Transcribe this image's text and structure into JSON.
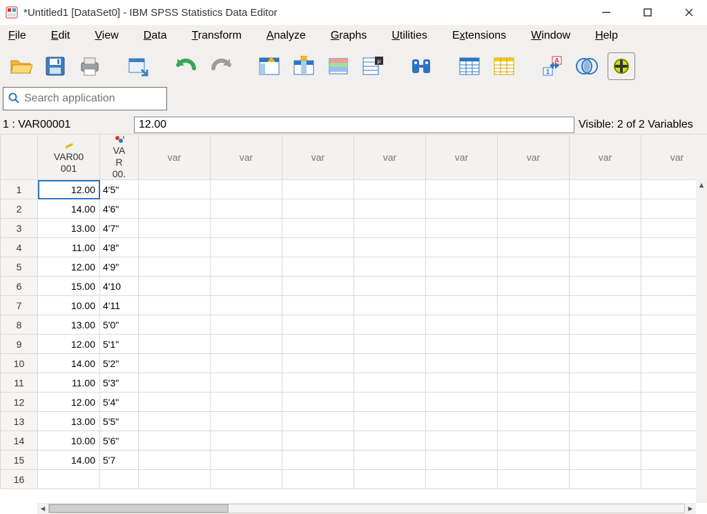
{
  "title": "*Untitled1 [DataSet0] - IBM SPSS Statistics Data Editor",
  "menu": {
    "file": {
      "label": "File",
      "ul": "F"
    },
    "edit": {
      "label": "Edit",
      "ul": "E"
    },
    "view": {
      "label": "View",
      "ul": "V"
    },
    "data": {
      "label": "Data",
      "ul": "D"
    },
    "transform": {
      "label": "Transform",
      "ul": "T"
    },
    "analyze": {
      "label": "Analyze",
      "ul": "A"
    },
    "graphs": {
      "label": "Graphs",
      "ul": "G"
    },
    "utilities": {
      "label": "Utilities",
      "ul": "U"
    },
    "extensions": {
      "label": "Extensions",
      "ul": "x"
    },
    "window": {
      "label": "Window",
      "ul": "W"
    },
    "help": {
      "label": "Help",
      "ul": "H"
    }
  },
  "search": {
    "placeholder": "Search application"
  },
  "cellref": {
    "label": "1 : VAR00001",
    "value": "12.00"
  },
  "visible": "Visible: 2 of 2 Variables",
  "headers": {
    "var1": "VAR00001",
    "var2": "VAR00.",
    "empty": "var"
  },
  "rows": [
    {
      "n": "1",
      "v1": "12.00",
      "v2": "4'5\""
    },
    {
      "n": "2",
      "v1": "14.00",
      "v2": "4'6\""
    },
    {
      "n": "3",
      "v1": "13.00",
      "v2": "4'7\""
    },
    {
      "n": "4",
      "v1": "11.00",
      "v2": "4'8\""
    },
    {
      "n": "5",
      "v1": "12.00",
      "v2": "4'9\""
    },
    {
      "n": "6",
      "v1": "15.00",
      "v2": "4'10"
    },
    {
      "n": "7",
      "v1": "10.00",
      "v2": "4'11"
    },
    {
      "n": "8",
      "v1": "13.00",
      "v2": "5'0\""
    },
    {
      "n": "9",
      "v1": "12.00",
      "v2": "5'1\""
    },
    {
      "n": "10",
      "v1": "14.00",
      "v2": "5'2\""
    },
    {
      "n": "11",
      "v1": "11.00",
      "v2": "5'3\""
    },
    {
      "n": "12",
      "v1": "12.00",
      "v2": "5'4\""
    },
    {
      "n": "13",
      "v1": "13.00",
      "v2": "5'5\""
    },
    {
      "n": "14",
      "v1": "10.00",
      "v2": "5'6\""
    },
    {
      "n": "15",
      "v1": "14.00",
      "v2": "5'7"
    },
    {
      "n": "16",
      "v1": "",
      "v2": ""
    }
  ],
  "headers_line1": {
    "var1": "VAR00",
    "var2": "VA"
  },
  "headers_line2": {
    "var1": "001",
    "var2": "R"
  },
  "headers_line3": {
    "var2": "00."
  }
}
